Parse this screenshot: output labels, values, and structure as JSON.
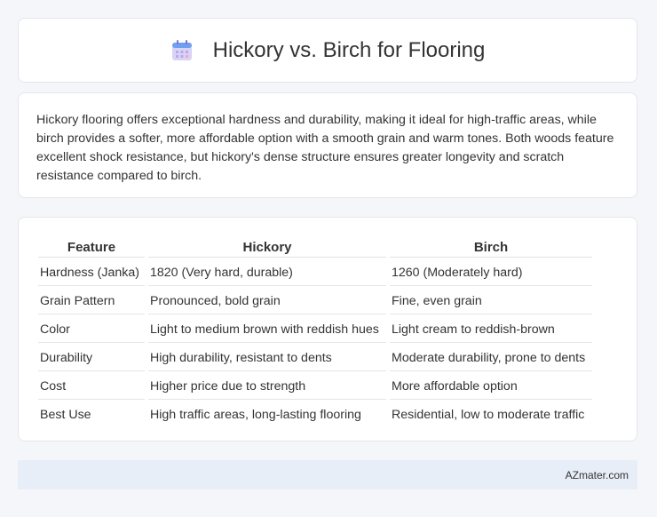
{
  "header": {
    "title": "Hickory vs. Birch for Flooring",
    "icon": "calendar-icon"
  },
  "summary": {
    "text": "Hickory flooring offers exceptional hardness and durability, making it ideal for high-traffic areas, while birch provides a softer, more affordable option with a smooth grain and warm tones. Both woods feature excellent shock resistance, but hickory's dense structure ensures greater longevity and scratch resistance compared to birch."
  },
  "table": {
    "headers": [
      "Feature",
      "Hickory",
      "Birch"
    ],
    "rows": [
      [
        "Hardness (Janka)",
        "1820 (Very hard, durable)",
        "1260 (Moderately hard)"
      ],
      [
        "Grain Pattern",
        "Pronounced, bold grain",
        "Fine, even grain"
      ],
      [
        "Color",
        "Light to medium brown with reddish hues",
        "Light cream to reddish-brown"
      ],
      [
        "Durability",
        "High durability, resistant to dents",
        "Moderate durability, prone to dents"
      ],
      [
        "Cost",
        "Higher price due to strength",
        "More affordable option"
      ],
      [
        "Best Use",
        "High traffic areas, long-lasting flooring",
        "Residential, low to moderate traffic"
      ]
    ]
  },
  "footer": {
    "text": "AZmater.com"
  },
  "colors": {
    "background": "#f5f6f9",
    "card": "#ffffff",
    "footer_bg": "#e8eef7",
    "icon_accent": "#8a7fd8"
  }
}
